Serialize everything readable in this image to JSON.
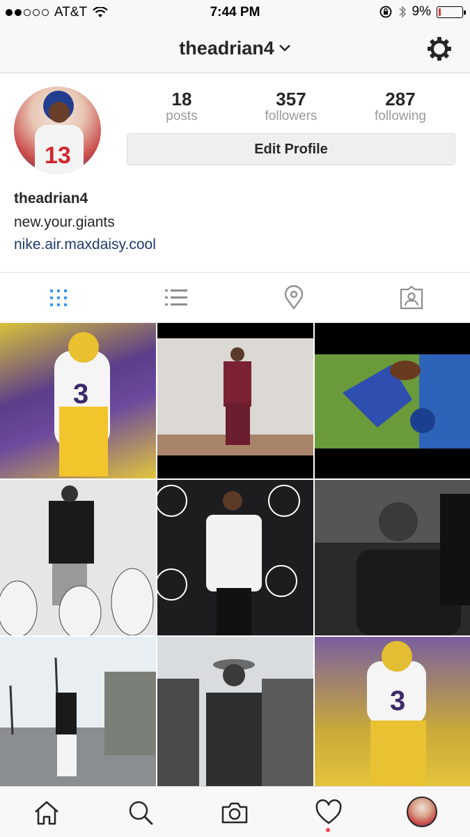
{
  "status_bar": {
    "carrier": "AT&T",
    "time": "7:44 PM",
    "battery_percent": "9%",
    "battery_level": 0.09,
    "signal_bars_filled": 2,
    "signal_bars_total": 5
  },
  "nav": {
    "username": "theadrian4",
    "dropdown_icon": "chevron-down-icon",
    "settings_icon": "gear-icon"
  },
  "profile": {
    "stats": [
      {
        "value": "18",
        "label": "posts"
      },
      {
        "value": "357",
        "label": "followers"
      },
      {
        "value": "287",
        "label": "following"
      }
    ],
    "edit_button_label": "Edit Profile",
    "display_name": "theadrian4",
    "bio": "new.your.giants",
    "website": "nike.air.maxdaisy.cool"
  },
  "tabs": [
    {
      "icon": "grid-icon",
      "active": true
    },
    {
      "icon": "list-icon",
      "active": false
    },
    {
      "icon": "location-pin-icon",
      "active": false
    },
    {
      "icon": "tagged-photos-icon",
      "active": false
    }
  ],
  "grid_tiles": [
    {
      "name": "lsu-player-3-photo"
    },
    {
      "name": "studio-maroon-suit-photo"
    },
    {
      "name": "diving-catch-photo"
    },
    {
      "name": "penguins-bw-photo"
    },
    {
      "name": "espys-red-carpet-photo"
    },
    {
      "name": "car-bw-photo"
    },
    {
      "name": "palm-trees-catch-photo"
    },
    {
      "name": "clothing-rack-photo"
    },
    {
      "name": "lsu-player-3-action-photo"
    }
  ],
  "tabbar": [
    {
      "icon": "home-icon"
    },
    {
      "icon": "search-icon"
    },
    {
      "icon": "camera-icon"
    },
    {
      "icon": "heart-icon"
    },
    {
      "icon": "profile-avatar-icon"
    }
  ],
  "colors": {
    "accent_blue": "#3897f0",
    "link_blue": "#1b3a6b",
    "battery_red": "#e0343b",
    "notification_red": "#ed4956",
    "muted_gray": "#9a9a9a"
  }
}
